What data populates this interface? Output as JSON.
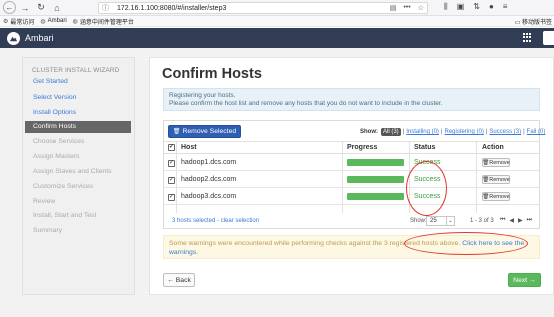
{
  "browser": {
    "url": "172.16.1.100:8080/#/installer/step3",
    "more": "•••",
    "bookmarks": [
      {
        "icon": "gear-icon",
        "label": "最常访问"
      },
      {
        "icon": "globe-icon",
        "label": "Ambari"
      },
      {
        "icon": "globe-icon",
        "label": "涵意中间件管理平台"
      }
    ],
    "mobile_bookmarks": "移动版书签"
  },
  "app": {
    "title": "Ambari"
  },
  "sidebar": {
    "title": "CLUSTER INSTALL WIZARD",
    "items": [
      {
        "label": "Get Started",
        "state": "done"
      },
      {
        "label": "Select Version",
        "state": "done"
      },
      {
        "label": "Install Options",
        "state": "done"
      },
      {
        "label": "Confirm Hosts",
        "state": "active"
      },
      {
        "label": "Choose Services",
        "state": "todo"
      },
      {
        "label": "Assign Masters",
        "state": "todo"
      },
      {
        "label": "Assign Slaves and Clients",
        "state": "todo"
      },
      {
        "label": "Customize Services",
        "state": "todo"
      },
      {
        "label": "Review",
        "state": "todo"
      },
      {
        "label": "Install, Start and Test",
        "state": "todo"
      },
      {
        "label": "Summary",
        "state": "todo"
      }
    ]
  },
  "main": {
    "title": "Confirm Hosts",
    "info_line1": "Registering your hosts.",
    "info_line2": "Please confirm the host list and remove any hosts that you do not want to include in the cluster.",
    "remove_selected": "Remove Selected",
    "filter": {
      "show_label": "Show:",
      "all": "All (3)",
      "installing": "Installing (0)",
      "registering": "Registering (0)",
      "success": "Success (3)",
      "fail": "Fail (0)",
      "sep": "|"
    },
    "columns": {
      "host": "Host",
      "progress": "Progress",
      "status": "Status",
      "action": "Action"
    },
    "rows": [
      {
        "host": "hadoop1.dcs.com",
        "progress": 1.0,
        "status": "Success",
        "action": "Remove"
      },
      {
        "host": "hadoop2.dcs.com",
        "progress": 1.0,
        "status": "Success",
        "action": "Remove"
      },
      {
        "host": "hadoop3.dcs.com",
        "progress": 1.0,
        "status": "Success",
        "action": "Remove"
      }
    ],
    "footer": {
      "selected": "3 hosts selected - clear selection",
      "show": "Show:",
      "per_page": "25",
      "range": "1 - 3 of 3"
    },
    "warning_text": "Some warnings were encountered while performing checks against the 3 registered hosts above.",
    "warning_link": "Click here to see the warnings.",
    "back": "← Back",
    "next": "Next →"
  },
  "colors": {
    "header_bg": "#303d54",
    "primary": "#2e5fb3",
    "success": "#5cb85c",
    "annotation": "#e3342f"
  }
}
